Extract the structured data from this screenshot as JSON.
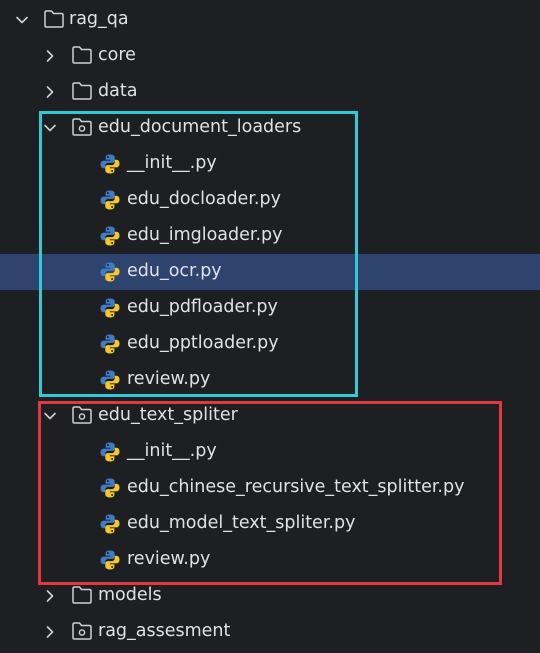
{
  "project_tree": {
    "root": {
      "label": "rag_qa",
      "icon": "folder-icon",
      "expanded": true
    },
    "core": {
      "label": "core",
      "icon": "folder-icon",
      "expanded": false
    },
    "data": {
      "label": "data",
      "icon": "folder-icon",
      "expanded": false
    },
    "edu_document_loaders": {
      "label": "edu_document_loaders",
      "icon": "package-folder-icon",
      "expanded": true,
      "highlight_color": "#2ecad6",
      "files": [
        {
          "label": "__init__.py",
          "icon": "python-file-icon"
        },
        {
          "label": "edu_docloader.py",
          "icon": "python-file-icon"
        },
        {
          "label": "edu_imgloader.py",
          "icon": "python-file-icon"
        },
        {
          "label": "edu_ocr.py",
          "icon": "python-file-icon",
          "selected": true
        },
        {
          "label": "edu_pdfloader.py",
          "icon": "python-file-icon"
        },
        {
          "label": "edu_pptloader.py",
          "icon": "python-file-icon"
        },
        {
          "label": "review.py",
          "icon": "python-file-icon"
        }
      ]
    },
    "edu_text_spliter": {
      "label": "edu_text_spliter",
      "icon": "package-folder-icon",
      "expanded": true,
      "highlight_color": "#e0393e",
      "files": [
        {
          "label": "__init__.py",
          "icon": "python-file-icon"
        },
        {
          "label": "edu_chinese_recursive_text_splitter.py",
          "icon": "python-file-icon"
        },
        {
          "label": "edu_model_text_spliter.py",
          "icon": "python-file-icon"
        },
        {
          "label": "review.py",
          "icon": "python-file-icon"
        }
      ]
    },
    "models": {
      "label": "models",
      "icon": "folder-icon",
      "expanded": false
    },
    "rag_assesment": {
      "label": "rag_assesment",
      "icon": "package-folder-icon",
      "expanded": false
    }
  },
  "colors": {
    "background": "#1e1f22",
    "selection": "#2e436e",
    "text": "#dfe1e5",
    "icon_gray": "#ced0d6",
    "python_blue": "#3f7cc7",
    "python_yellow": "#f5c62e"
  }
}
